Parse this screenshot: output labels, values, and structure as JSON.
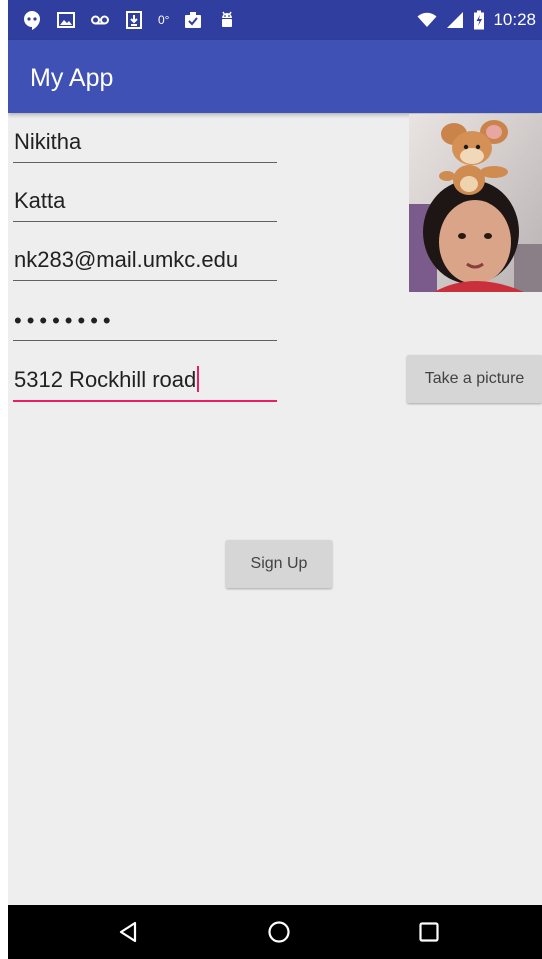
{
  "status_bar": {
    "time": "10:28",
    "temperature": "0°",
    "left_icons": [
      "hangouts-icon",
      "gallery-icon",
      "voicemail-icon",
      "download-icon",
      "temperature-icon",
      "clipboard-check-icon",
      "android-debug-icon"
    ],
    "right_icons": [
      "wifi-icon",
      "cell-signal-icon",
      "battery-charging-icon"
    ]
  },
  "app_bar": {
    "title": "My App"
  },
  "form": {
    "first_name": "Nikitha",
    "last_name": "Katta",
    "email": "nk283@mail.umkc.edu",
    "password_masked": "••••••••",
    "address": "5312 Rockhill road"
  },
  "buttons": {
    "take_picture": "Take a picture",
    "sign_up": "Sign Up"
  },
  "nav": {
    "icons": [
      "back-icon",
      "home-icon",
      "recents-icon"
    ]
  },
  "colors": {
    "primary_dark": "#303f9f",
    "primary": "#3f51b5",
    "accent": "#e91e63",
    "background": "#eeeeee",
    "button": "#d6d6d6"
  }
}
